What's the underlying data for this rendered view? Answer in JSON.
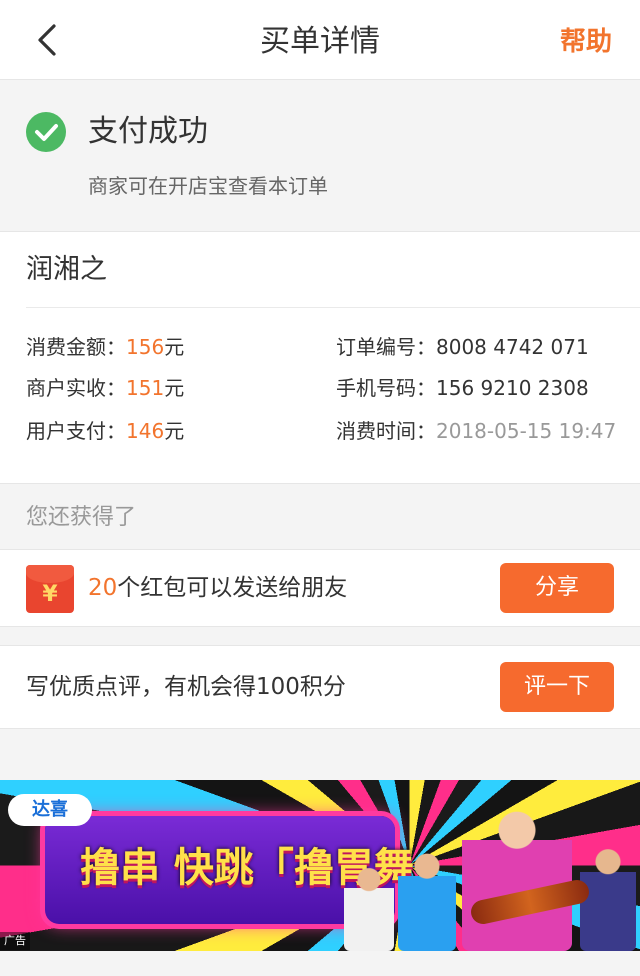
{
  "nav": {
    "title": "买单详情",
    "help": "帮助"
  },
  "status": {
    "title": "支付成功",
    "subtitle": "商家可在开店宝查看本订单",
    "icon": "check-circle-icon",
    "icon_color": "#4cb963"
  },
  "merchant": {
    "name": "润湘之"
  },
  "details": {
    "left": [
      {
        "label": "消费金额：",
        "value": "156",
        "unit": "元"
      },
      {
        "label": "商户实收：",
        "value": "151",
        "unit": "元"
      },
      {
        "label": "用户支付：",
        "value": "146",
        "unit": "元"
      }
    ],
    "right": [
      {
        "label": "订单编号：",
        "value": "8008 4742 071"
      },
      {
        "label": "手机号码：",
        "value": "156 9210 2308"
      },
      {
        "label": "消费时间：",
        "value": "2018-05-15 19:47"
      }
    ]
  },
  "rewards": {
    "section_label": "您还获得了",
    "red_packet": {
      "count": "20",
      "text": "个红包可以发送给朋友",
      "icon": "red-packet-icon",
      "icon_glyph": "¥",
      "button": "分享"
    },
    "review": {
      "text": "写优质点评，有机会得100积分",
      "button": "评一下"
    }
  },
  "banner": {
    "brand": "达喜",
    "headline": "撸串 快跳「撸胃舞」",
    "ad_label": "广告"
  },
  "colors": {
    "accent": "#f2742d",
    "button": "#f66a2e",
    "success": "#4cb963"
  }
}
